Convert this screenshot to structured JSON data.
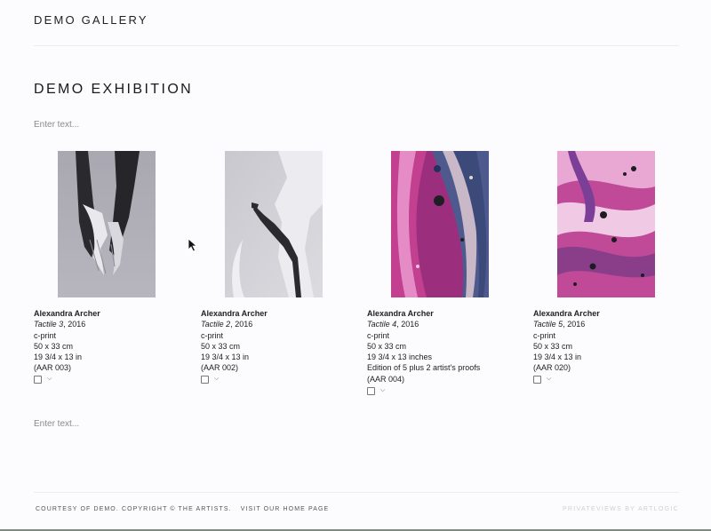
{
  "header": {
    "gallery_title": "DEMO GALLERY"
  },
  "exhibition": {
    "title": "DEMO EXHIBITION",
    "intro_placeholder": "Enter text...",
    "outro_placeholder": "Enter text..."
  },
  "artworks": [
    {
      "artist": "Alexandra Archer",
      "title": "Tactile 3",
      "year": ", 2016",
      "medium": "c-print",
      "dimensions_cm": "50 x 33 cm",
      "dimensions_in": "19 3/4 x 13 in",
      "edition": "",
      "ref": "(AAR 003)",
      "image_icon": "hands-photo"
    },
    {
      "artist": "Alexandra Archer",
      "title": "Tactile 2",
      "year": ", 2016",
      "medium": "c-print",
      "dimensions_cm": "50 x 33 cm",
      "dimensions_in": "19 3/4 x 13 in",
      "edition": "",
      "ref": "(AAR 002)",
      "image_icon": "fabric-arm-photo"
    },
    {
      "artist": "Alexandra Archer",
      "title": "Tactile 4",
      "year": ", 2016",
      "medium": "c-print",
      "dimensions_cm": "50 x 33 cm",
      "dimensions_in": "19 3/4 x 13 inches",
      "edition": "Edition of 5 plus 2 artist's proofs",
      "ref": "(AAR 004)",
      "image_icon": "pink-marble-photo"
    },
    {
      "artist": "Alexandra Archer",
      "title": "Tactile 5",
      "year": ", 2016",
      "medium": "c-print",
      "dimensions_cm": "50 x 33 cm",
      "dimensions_in": "19 3/4 x 13 in",
      "edition": "",
      "ref": "(AAR 020)",
      "image_icon": "pink-bubbles-photo"
    }
  ],
  "footer": {
    "courtesy": "COURTESY OF DEMO. COPYRIGHT © THE ARTISTS.",
    "home_link": "VISIT OUR HOME PAGE",
    "powered_by": "PRIVATEVIEWS BY ARTLOGIC"
  }
}
